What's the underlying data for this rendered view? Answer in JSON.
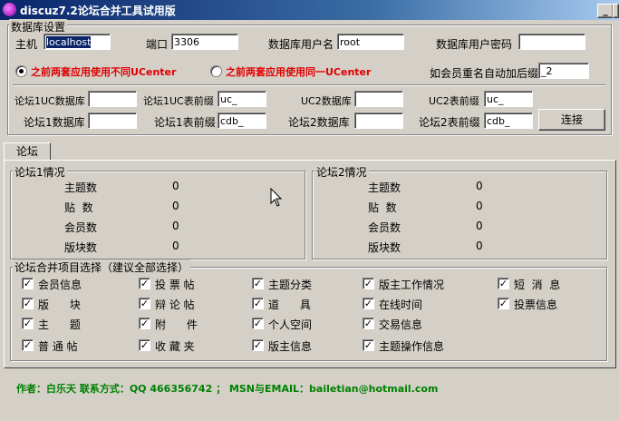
{
  "window": {
    "title": "discuz7.2论坛合并工具试用版",
    "min": "_",
    "close": "×"
  },
  "db": {
    "group": "数据库设置",
    "host_label": "主机",
    "host_value": "localhost",
    "port_label": "端口",
    "port_value": "3306",
    "user_label": "数据库用户名",
    "user_value": "root",
    "pass_label": "数据库用户密码",
    "pass_value": ""
  },
  "opts": {
    "radio1": "之前两套应用使用不同UCenter",
    "radio2": "之前两套应用使用同一UCenter",
    "suffix_label": "如会员重名自动加后缀",
    "suffix_value": "_2"
  },
  "conn": {
    "uc1db_label": "论坛1UC数据库",
    "uc1db_value": "",
    "uc1pre_label": "论坛1UC表前缀",
    "uc1pre_value": "uc_",
    "uc2db_label": "UC2数据库",
    "uc2db_value": "",
    "uc2pre_label": "UC2表前缀",
    "uc2pre_value": "uc_",
    "f1db_label": "论坛1数据库",
    "f1db_value": "",
    "f1pre_label": "论坛1表前缀",
    "f1pre_value": "cdb_",
    "f2db_label": "论坛2数据库",
    "f2db_value": "",
    "f2pre_label": "论坛2表前缀",
    "f2pre_value": "cdb_",
    "connect": "连接"
  },
  "tab": "论坛",
  "forum1": {
    "group": "论坛1情况",
    "rows": [
      {
        "label": "主题数",
        "value": "0"
      },
      {
        "label": "贴  数",
        "value": "0"
      },
      {
        "label": "会员数",
        "value": "0"
      },
      {
        "label": "版块数",
        "value": "0"
      }
    ]
  },
  "forum2": {
    "group": "论坛2情况",
    "rows": [
      {
        "label": "主题数",
        "value": "0"
      },
      {
        "label": "贴  数",
        "value": "0"
      },
      {
        "label": "会员数",
        "value": "0"
      },
      {
        "label": "版块数",
        "value": "0"
      }
    ]
  },
  "merge": {
    "group": "论坛合并项目选择（建议全部选择）",
    "items": [
      "会员信息",
      "投 票 帖",
      "主题分类",
      "版主工作情况",
      "短  消  息",
      "版      块",
      "辩 论 帖",
      "道      具",
      "在线时间",
      "投票信息",
      "主      题",
      "附      件",
      "个人空间",
      "交易信息",
      "普 通 帖",
      "收 藏 夹",
      "版主信息",
      "主题操作信息"
    ]
  },
  "footer": "作者：白乐天   联系方式：QQ 466356742 ；  MSN与EMAIL：bailetian@hotmail.com"
}
